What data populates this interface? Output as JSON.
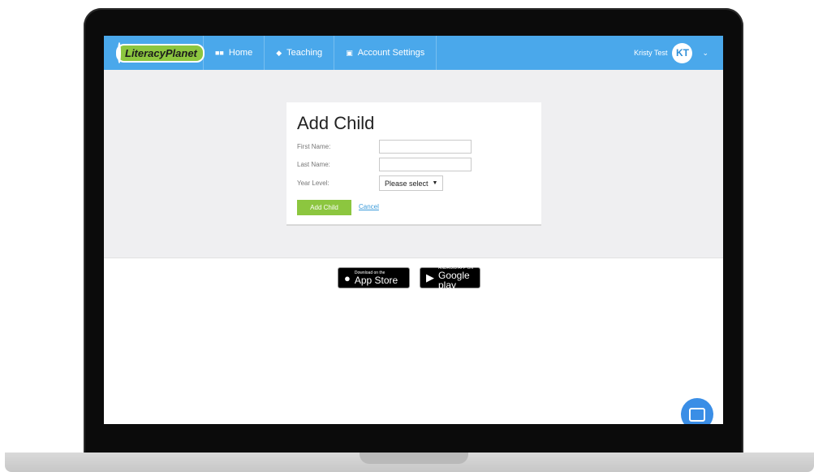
{
  "nav": {
    "logo_text": "LiteracyPlanet",
    "items": [
      {
        "label": "Home",
        "icon": "grid-icon"
      },
      {
        "label": "Teaching",
        "icon": "graduation-cap-icon"
      },
      {
        "label": "Account Settings",
        "icon": "id-card-icon"
      }
    ],
    "user_name": "Kristy Test",
    "user_initials": "KT"
  },
  "form": {
    "title": "Add Child",
    "first_name_label": "First Name:",
    "first_name_value": "",
    "last_name_label": "Last Name:",
    "last_name_value": "",
    "year_level_label": "Year Level:",
    "year_level_selected": "Please select",
    "submit_label": "Add Child",
    "cancel_label": "Cancel"
  },
  "badges": {
    "appstore_small": "Download on the",
    "appstore_big": "App Store",
    "googleplay_small": "ANDROID APP ON",
    "googleplay_big": "Google play"
  },
  "colors": {
    "nav_bg": "#4aa8eb",
    "accent_green": "#8cc63f",
    "link_blue": "#3a9ad9"
  }
}
